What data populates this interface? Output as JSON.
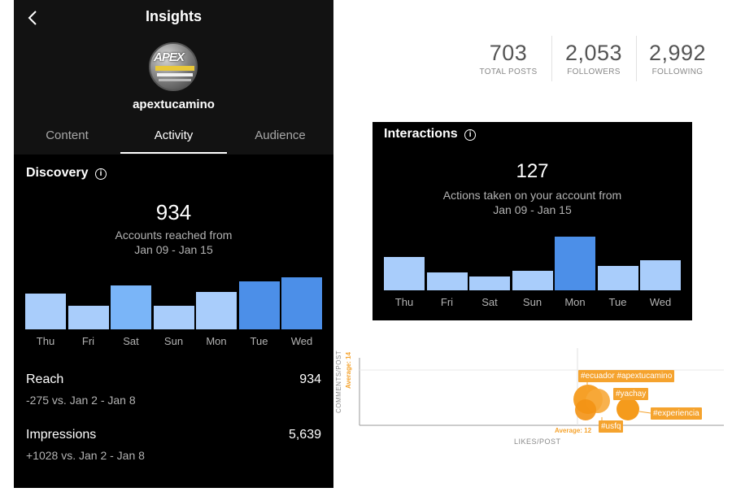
{
  "header": {
    "title": "Insights"
  },
  "profile": {
    "username": "apextucamino",
    "avatar_text": "APEX"
  },
  "tabs": [
    {
      "label": "Content",
      "active": false
    },
    {
      "label": "Activity",
      "active": true
    },
    {
      "label": "Audience",
      "active": false
    }
  ],
  "discovery": {
    "title": "Discovery",
    "value": "934",
    "desc_line1": "Accounts reached from",
    "desc_line2": "Jan 09 - Jan 15",
    "days": [
      "Thu",
      "Fri",
      "Sat",
      "Sun",
      "Mon",
      "Tue",
      "Wed"
    ],
    "levels": [
      0.68,
      0.46,
      0.85,
      0.45,
      0.72,
      0.92,
      1.0
    ],
    "highlight": [
      false,
      false,
      false,
      false,
      false,
      true,
      true
    ]
  },
  "reach": {
    "label": "Reach",
    "value": "934",
    "sub": "-275 vs. Jan 2 - Jan 8"
  },
  "impressions": {
    "label": "Impressions",
    "value": "5,639",
    "sub": "+1028 vs. Jan 2 - Jan 8"
  },
  "stats": [
    {
      "value": "703",
      "label": "TOTAL POSTS"
    },
    {
      "value": "2,053",
      "label": "FOLLOWERS"
    },
    {
      "value": "2,992",
      "label": "FOLLOWING"
    }
  ],
  "interactions": {
    "title": "Interactions",
    "value": "127",
    "desc_line1": "Actions taken on your account from",
    "desc_line2": "Jan 09 - Jan 15",
    "days": [
      "Thu",
      "Fri",
      "Sat",
      "Sun",
      "Mon",
      "Tue",
      "Wed"
    ],
    "levels": [
      0.62,
      0.34,
      0.25,
      0.37,
      1.0,
      0.45,
      0.56
    ],
    "highlight": [
      false,
      false,
      false,
      false,
      true,
      false,
      false
    ]
  },
  "bubble_chart": {
    "x_axis_label": "LIKES/POST",
    "y_axis_label": "COMMENTS/POST",
    "avg_x_label": "Average: 12",
    "avg_y_label": "Average: 14",
    "tags": [
      "#ecuador",
      "#yachay",
      "#experiencia",
      "#usfq",
      "#apextucamino"
    ]
  },
  "colors": {
    "bar_light": "#a9cdfb",
    "bar_mid": "#7ab5f8",
    "bar_dark": "#4c8fe8",
    "orange": "#f5a32e"
  }
}
